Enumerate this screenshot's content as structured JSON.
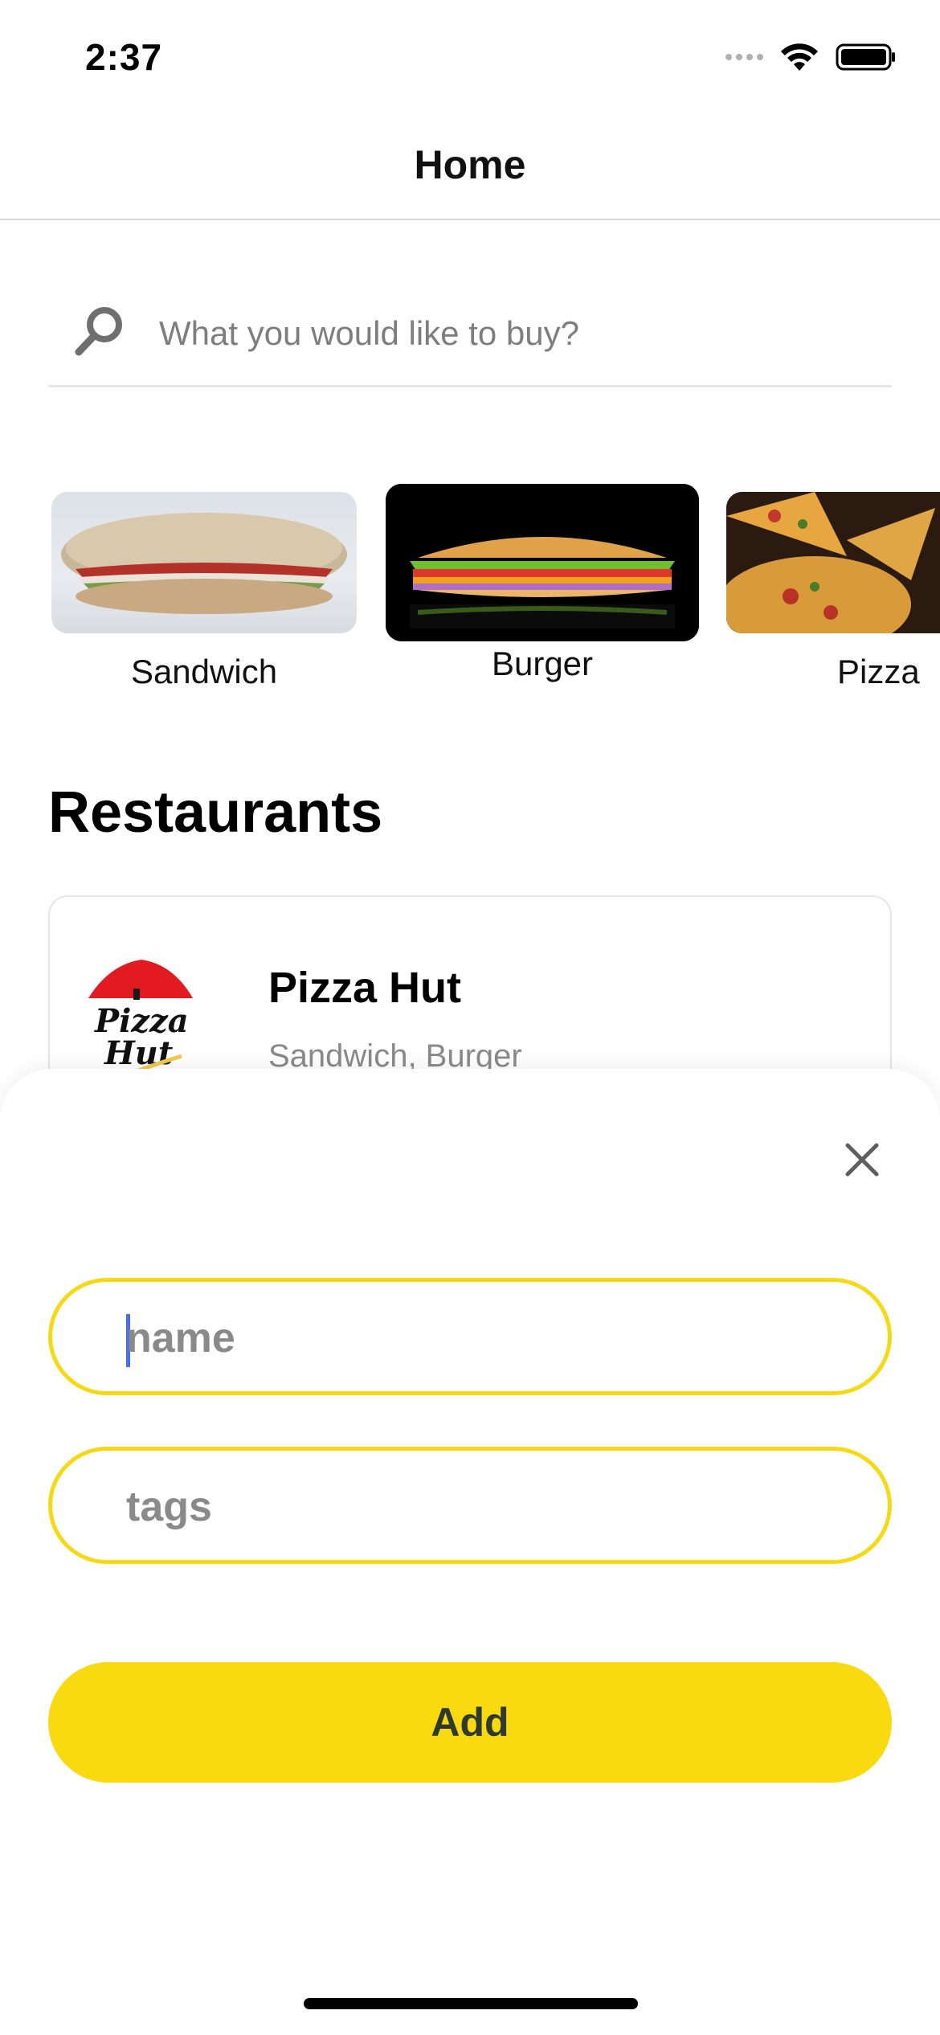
{
  "status_bar": {
    "time": "2:37"
  },
  "nav": {
    "title": "Home"
  },
  "search": {
    "placeholder": "What you would like to buy?"
  },
  "categories": [
    {
      "label": "Sandwich"
    },
    {
      "label": "Burger"
    },
    {
      "label": "Pizza"
    }
  ],
  "restaurants": {
    "section_title": "Restaurants",
    "items": [
      {
        "name": "Pizza Hut",
        "tags": "Sandwich, Burger",
        "logo_text": "Pizza Hut"
      }
    ]
  },
  "sheet": {
    "name_placeholder": "name",
    "tags_placeholder": "tags",
    "add_label": "Add"
  },
  "colors": {
    "accent": "#f9d90f",
    "field_border": "#f5d914",
    "caret": "#4a6cf0"
  }
}
